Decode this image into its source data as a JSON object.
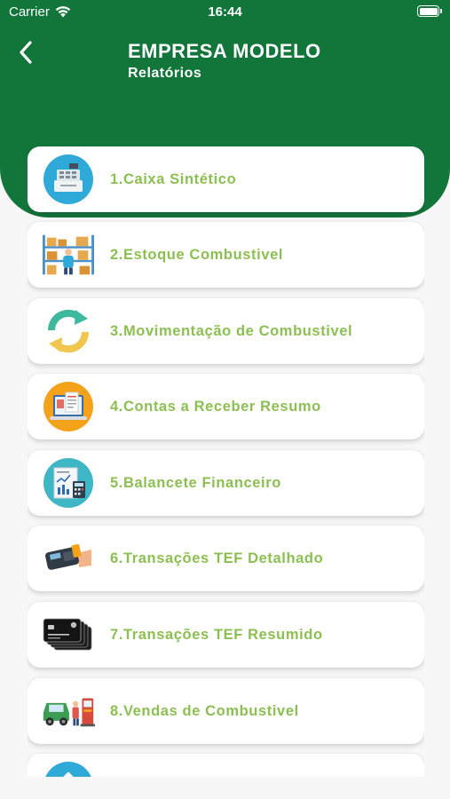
{
  "status_bar": {
    "carrier": "Carrier",
    "time": "16:44"
  },
  "header": {
    "title": "EMPRESA MODELO",
    "subtitle": "Relatórios"
  },
  "colors": {
    "header_green": "#12753a",
    "label_green": "#8cbf52"
  },
  "reports": [
    {
      "label": "1.Caixa Sintético",
      "icon": "cash-register-icon"
    },
    {
      "label": "2.Estoque Combustivel",
      "icon": "warehouse-stock-icon"
    },
    {
      "label": "3.Movimentação de Combustivel",
      "icon": "cycle-arrows-icon"
    },
    {
      "label": "4.Contas a Receber Resumo",
      "icon": "invoice-screen-icon"
    },
    {
      "label": "5.Balancete Financeiro",
      "icon": "financial-report-icon"
    },
    {
      "label": "6.Transações TEF Detalhado",
      "icon": "card-terminal-icon"
    },
    {
      "label": "7.Transações TEF Resumido",
      "icon": "credit-cards-icon"
    },
    {
      "label": "8.Vendas de Combustivel",
      "icon": "fuel-pump-car-icon"
    },
    {
      "label": "",
      "icon": "upload-icon"
    }
  ]
}
